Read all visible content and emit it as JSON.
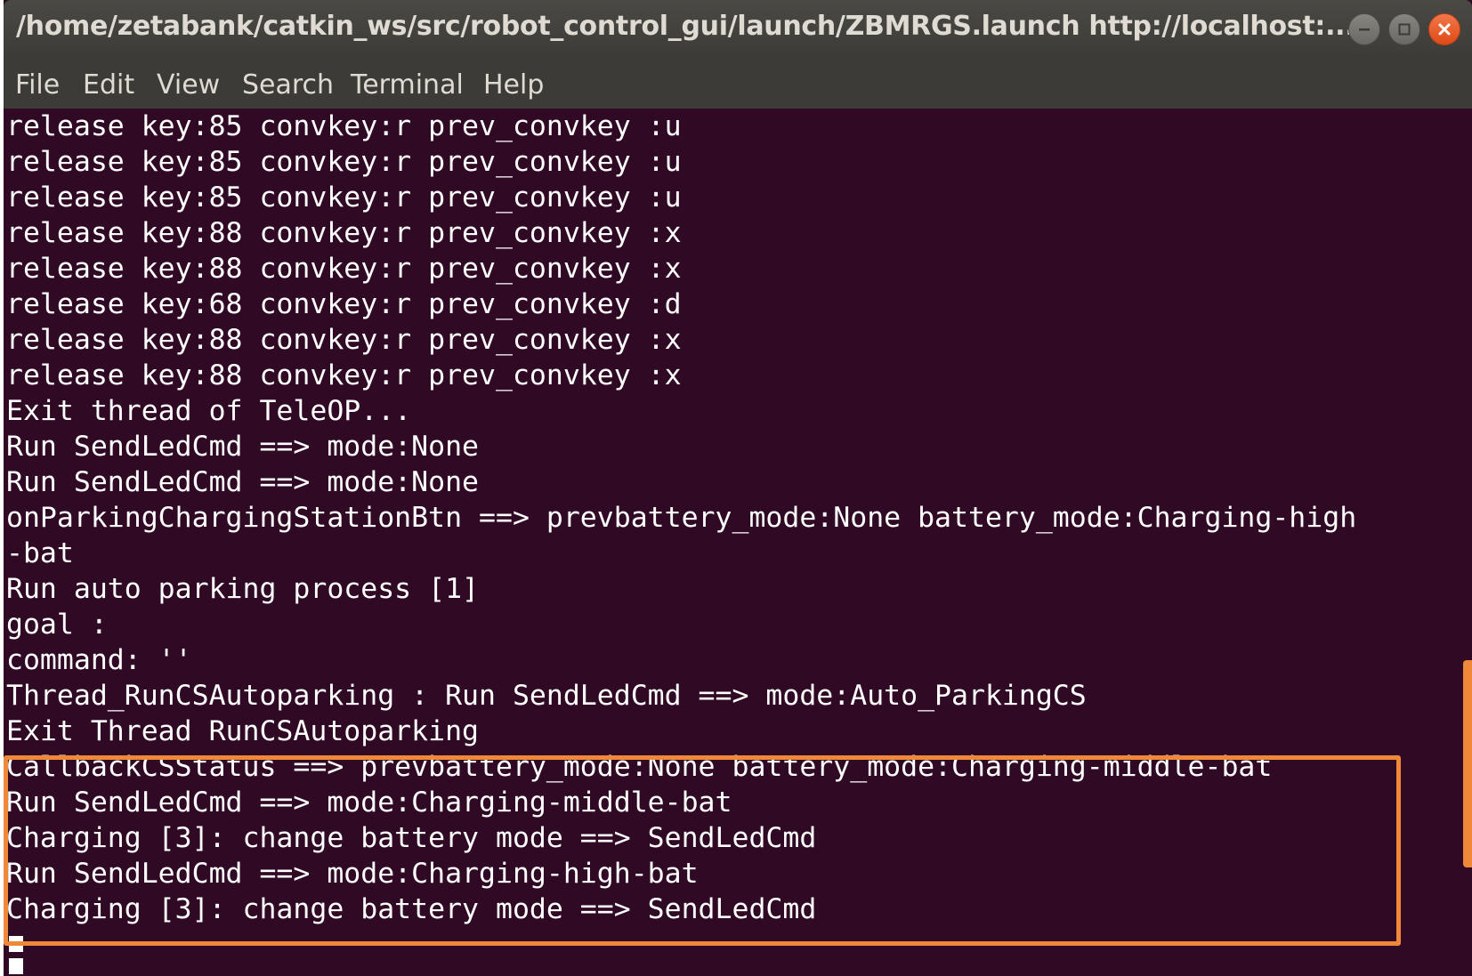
{
  "window": {
    "title": "/home/zetabank/catkin_ws/src/robot_control_gui/launch/ZBMRGS.launch http://localhost:..."
  },
  "menu": {
    "file": "File",
    "edit": "Edit",
    "view": "View",
    "search": "Search",
    "terminal": "Terminal",
    "help": "Help"
  },
  "terminal": {
    "lines": [
      "release key:85 convkey:r prev_convkey :u",
      "release key:85 convkey:r prev_convkey :u",
      "release key:85 convkey:r prev_convkey :u",
      "release key:88 convkey:r prev_convkey :x",
      "release key:88 convkey:r prev_convkey :x",
      "release key:68 convkey:r prev_convkey :d",
      "release key:88 convkey:r prev_convkey :x",
      "release key:88 convkey:r prev_convkey :x",
      "Exit thread of TeleOP...",
      "Run SendLedCmd ==> mode:None",
      "Run SendLedCmd ==> mode:None",
      "onParkingChargingStationBtn ==> prevbattery_mode:None battery_mode:Charging-high",
      "-bat",
      "Run auto parking process [1]",
      "goal :",
      "command: ''",
      "Thread_RunCSAutoparking : Run SendLedCmd ==> mode:Auto_ParkingCS",
      "Exit Thread RunCSAutoparking",
      "CallbackCSStatus ==> prevbattery_mode:None battery_mode:Charging-middle-bat",
      "Run SendLedCmd ==> mode:Charging-middle-bat",
      "Charging [3]: change battery mode ==> SendLedCmd",
      "Run SendLedCmd ==> mode:Charging-high-bat",
      "Charging [3]: change battery mode ==> SendLedCmd"
    ]
  },
  "colors": {
    "terminal_background": "#300a24",
    "terminal_text": "#ffffff",
    "highlight_border": "#f0883a",
    "titlebar": "#3c3b37",
    "close_button": "#df4a16"
  }
}
